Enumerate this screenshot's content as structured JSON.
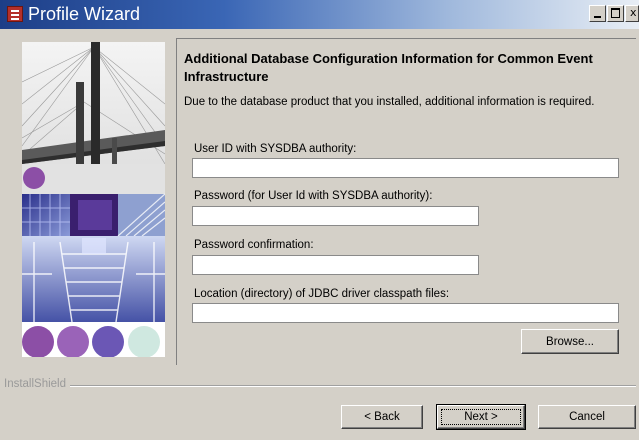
{
  "window": {
    "title": "Profile Wizard",
    "close_glyph": "x"
  },
  "page": {
    "title": "Additional Database Configuration Information for Common Event Infrastructure",
    "description": "Due to the database product that you installed, additional information is required."
  },
  "fields": {
    "user_id_label": "User ID with SYSDBA authority:",
    "user_id_value": "",
    "password_label": "Password (for User Id with SYSDBA authority):",
    "password_value": "",
    "confirm_label": "Password confirmation:",
    "confirm_value": "",
    "jdbc_label": "Location (directory) of JDBC driver classpath files:",
    "jdbc_value": ""
  },
  "buttons": {
    "browse": "Browse...",
    "back": "< Back",
    "next": "Next >",
    "cancel": "Cancel"
  },
  "footer": {
    "brand": "InstallShield"
  },
  "icons": {
    "app": "profile-wizard-icon",
    "minimize": "minimize-icon",
    "maximize": "maximize-icon",
    "close": "close-icon"
  },
  "colors": {
    "titlebar_start": "#1d3e87",
    "dialog_bg": "#d4d0c8",
    "circle_purple": "#8c4fa6"
  }
}
